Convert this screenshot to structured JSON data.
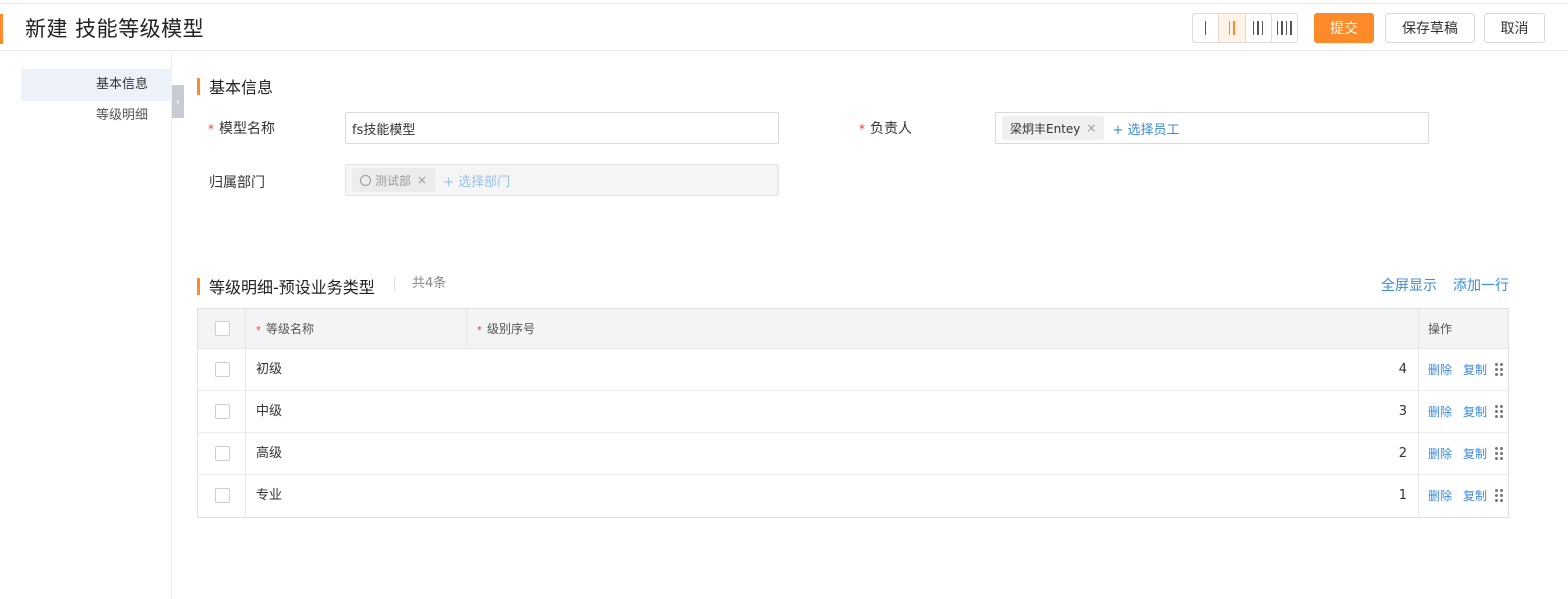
{
  "header": {
    "title": "新建 技能等级模型",
    "submit_label": "提交",
    "save_draft_label": "保存草稿",
    "cancel_label": "取消",
    "column_layout_options": [
      "1",
      "2",
      "3",
      "4"
    ],
    "column_layout_selected": "2"
  },
  "sidebar": {
    "items": [
      {
        "label": "基本信息",
        "active": true
      },
      {
        "label": "等级明细",
        "active": false
      }
    ]
  },
  "basic_info": {
    "section_title": "基本信息",
    "model_name": {
      "label": "模型名称",
      "required": true,
      "value": "fs技能模型"
    },
    "owner": {
      "label": "负责人",
      "required": true,
      "tag": "梁炯丰Entey",
      "add_label": "+ 选择员工"
    },
    "department": {
      "label": "归属部门",
      "required": false,
      "tag": "测试部",
      "add_label": "+ 选择部门"
    }
  },
  "levels": {
    "section_title": "等级明细-预设业务类型",
    "count_text": "共4条",
    "fullscreen_label": "全屏显示",
    "add_row_label": "添加一行",
    "columns": {
      "name": "等级名称",
      "order": "级别序号",
      "actions": "操作"
    },
    "delete_label": "删除",
    "copy_label": "复制",
    "rows": [
      {
        "name": "初级",
        "order": "4"
      },
      {
        "name": "中级",
        "order": "3"
      },
      {
        "name": "高级",
        "order": "2"
      },
      {
        "name": "专业",
        "order": "1"
      }
    ]
  },
  "colors": {
    "accent": "#ff8a2a",
    "link": "#3c8ae0",
    "required": "#f04134"
  }
}
